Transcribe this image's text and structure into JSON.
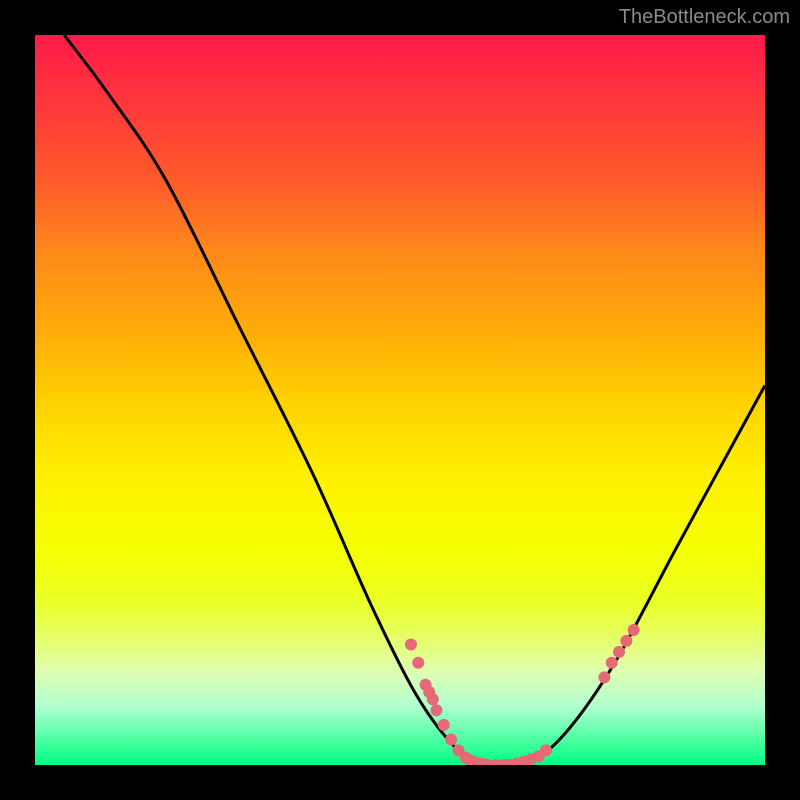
{
  "attribution": "TheBottleneck.com",
  "chart_data": {
    "type": "line",
    "title": "",
    "xlabel": "",
    "ylabel": "",
    "ylim": [
      0,
      100
    ],
    "xlim": [
      0,
      100
    ],
    "curve": [
      {
        "x": 4,
        "y": 100
      },
      {
        "x": 10,
        "y": 92
      },
      {
        "x": 18,
        "y": 80
      },
      {
        "x": 28,
        "y": 60
      },
      {
        "x": 38,
        "y": 40
      },
      {
        "x": 46,
        "y": 22
      },
      {
        "x": 52,
        "y": 10
      },
      {
        "x": 57,
        "y": 3
      },
      {
        "x": 61,
        "y": 0
      },
      {
        "x": 65,
        "y": 0
      },
      {
        "x": 69,
        "y": 1
      },
      {
        "x": 74,
        "y": 6
      },
      {
        "x": 80,
        "y": 15
      },
      {
        "x": 88,
        "y": 30
      },
      {
        "x": 100,
        "y": 52
      }
    ],
    "markers": [
      {
        "x": 51.5,
        "y": 16.5
      },
      {
        "x": 52.5,
        "y": 14
      },
      {
        "x": 53.5,
        "y": 11
      },
      {
        "x": 54,
        "y": 10
      },
      {
        "x": 54.5,
        "y": 9
      },
      {
        "x": 55,
        "y": 7.5
      },
      {
        "x": 56,
        "y": 5.5
      },
      {
        "x": 57,
        "y": 3.5
      },
      {
        "x": 58,
        "y": 2
      },
      {
        "x": 59,
        "y": 1
      },
      {
        "x": 59.5,
        "y": 0.7
      },
      {
        "x": 60,
        "y": 0.5
      },
      {
        "x": 61,
        "y": 0.2
      },
      {
        "x": 61.5,
        "y": 0.1
      },
      {
        "x": 62,
        "y": 0
      },
      {
        "x": 63,
        "y": 0
      },
      {
        "x": 64,
        "y": 0
      },
      {
        "x": 64.5,
        "y": 0
      },
      {
        "x": 65,
        "y": 0
      },
      {
        "x": 66,
        "y": 0.2
      },
      {
        "x": 67,
        "y": 0.5
      },
      {
        "x": 68,
        "y": 0.8
      },
      {
        "x": 69,
        "y": 1.2
      },
      {
        "x": 70,
        "y": 2
      },
      {
        "x": 78,
        "y": 12
      },
      {
        "x": 79,
        "y": 14
      },
      {
        "x": 80,
        "y": 15.5
      },
      {
        "x": 81,
        "y": 17
      },
      {
        "x": 82,
        "y": 18.5
      }
    ],
    "marker_color": "#e56977",
    "curve_color": "#000000"
  }
}
